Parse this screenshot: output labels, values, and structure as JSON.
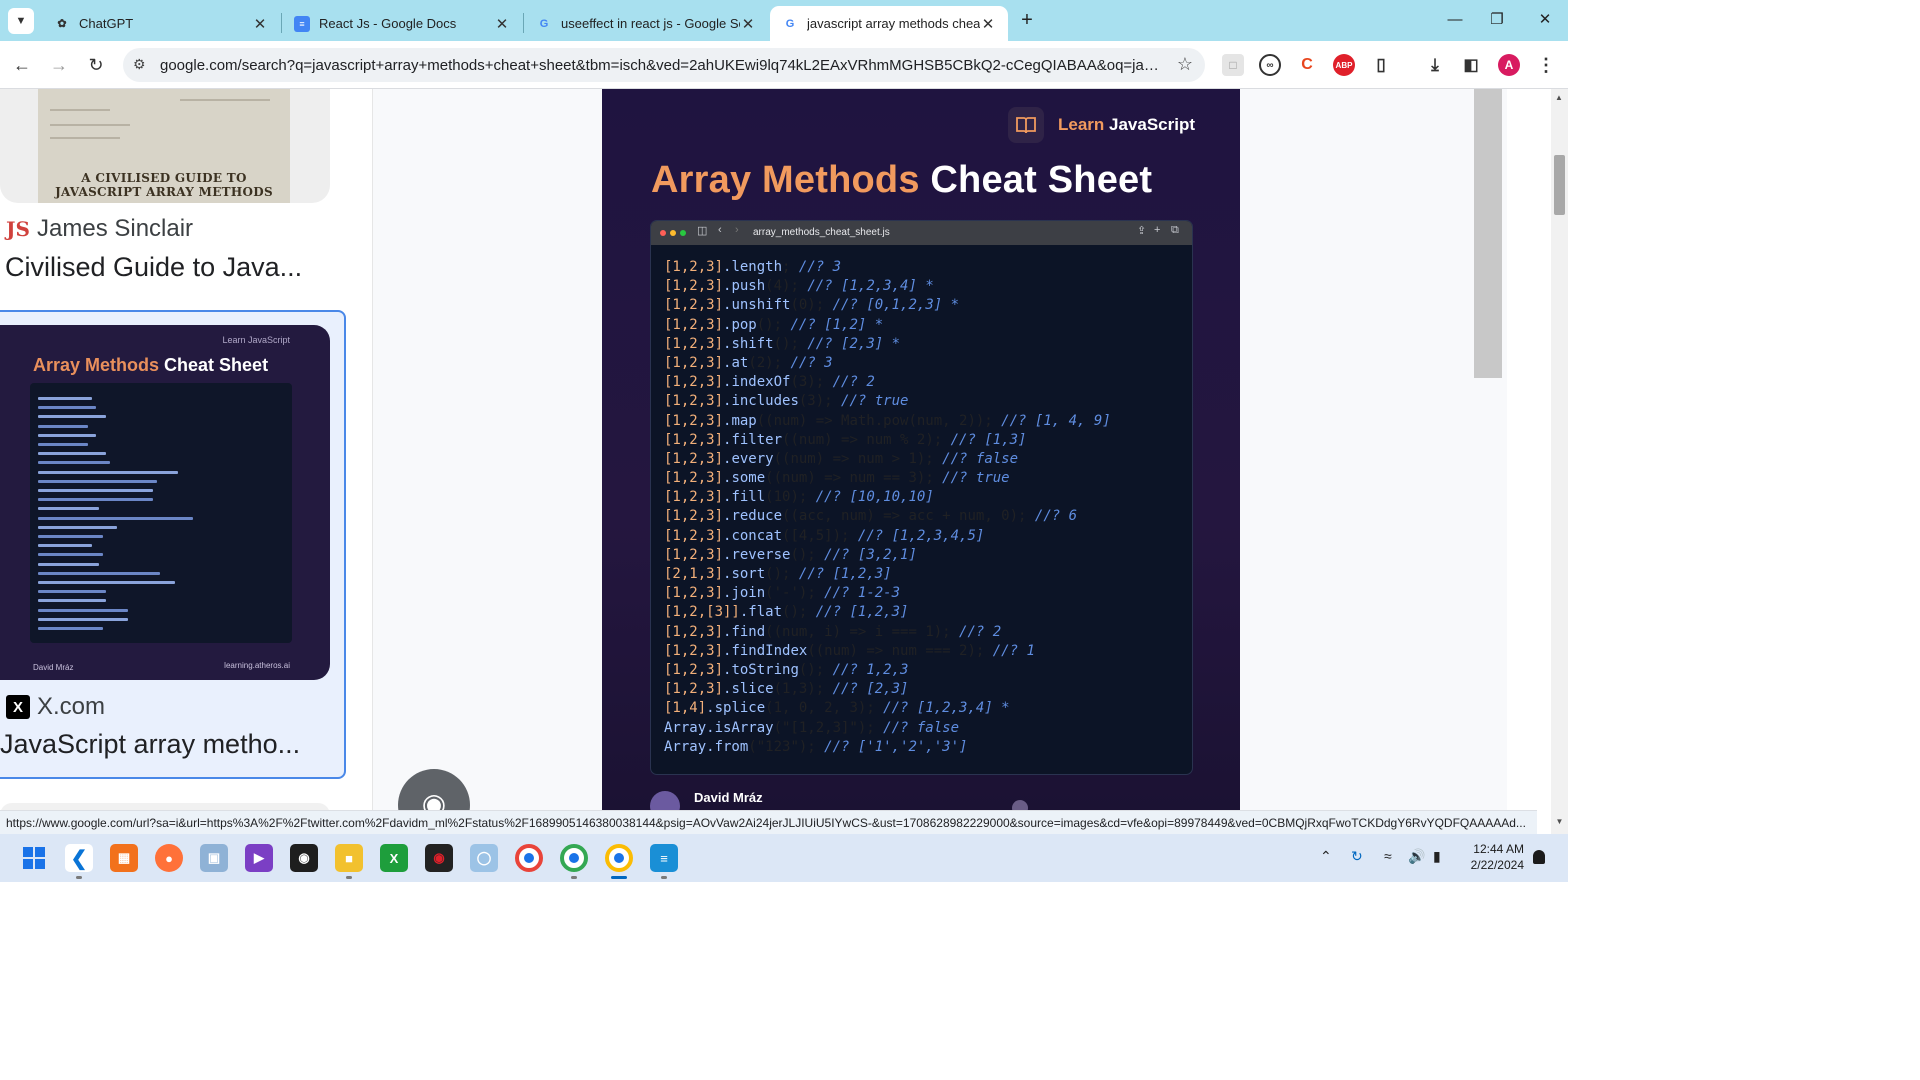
{
  "tabs": [
    {
      "title": "ChatGPT",
      "icon": "chatgpt-icon"
    },
    {
      "title": "React Js - Google Docs",
      "icon": "google-docs-icon"
    },
    {
      "title": "useeffect in react js - Google Se",
      "icon": "google-icon"
    },
    {
      "title": "javascript array methods cheat",
      "icon": "google-icon",
      "active": true
    }
  ],
  "toolbar": {
    "url": "google.com/search?q=javascript+array+methods+cheat+sheet&tbm=isch&ved=2ahUKEwi9lq74kL2EAxVRhmMGHSB5CBkQ2-cCegQIABAA&oq=javascript+a...",
    "profile_initial": "A"
  },
  "results": [
    {
      "thumb_caption": "A CIVILISED GUIDE TO JAVASCRIPT ARRAY METHODS",
      "source": "James Sinclair",
      "source_icon": "JS",
      "title": "Civilised Guide to Java..."
    },
    {
      "source": "X.com",
      "source_icon": "X",
      "title": "JavaScript array metho...",
      "selected": true,
      "thumb_brand": "Learn JavaScript",
      "thumb_title_hi": "Array Methods",
      "thumb_title_rest": " Cheat Sheet",
      "thumb_author": "David Mráz",
      "thumb_site": "learning.atheros.ai"
    }
  ],
  "sheet": {
    "brand_hi": "Learn",
    "brand_rest": " JavaScript",
    "title_hi": "Array Methods",
    "title_rest": " Cheat Sheet",
    "filename": "array_methods_cheat_sheet.js",
    "author": "David Mráz",
    "code": [
      {
        "arr": "[1,2,3]",
        "call": ".length",
        "args": ";",
        "cmt": " //? 3"
      },
      {
        "arr": "[1,2,3]",
        "call": ".push",
        "args": "(4);",
        "cmt": " //? [1,2,3,4] *"
      },
      {
        "arr": "[1,2,3]",
        "call": ".unshift",
        "args": "(0);",
        "cmt": " //? [0,1,2,3] *"
      },
      {
        "arr": "[1,2,3]",
        "call": ".pop",
        "args": "();",
        "cmt": " //? [1,2] *"
      },
      {
        "arr": "[1,2,3]",
        "call": ".shift",
        "args": "();",
        "cmt": " //? [2,3] *"
      },
      {
        "arr": "[1,2,3]",
        "call": ".at",
        "args": "(2);",
        "cmt": " //? 3"
      },
      {
        "arr": "[1,2,3]",
        "call": ".indexOf",
        "args": "(3);",
        "cmt": " //? 2"
      },
      {
        "arr": "[1,2,3]",
        "call": ".includes",
        "args": "(3);",
        "cmt": " //? true"
      },
      {
        "arr": "[1,2,3]",
        "call": ".map",
        "args": "((num) => Math.pow(num, 2));",
        "cmt": " //? [1, 4, 9]"
      },
      {
        "arr": "[1,2,3]",
        "call": ".filter",
        "args": "((num) => num % 2);",
        "cmt": " //? [1,3]"
      },
      {
        "arr": "[1,2,3]",
        "call": ".every",
        "args": "((num) => num > 1);",
        "cmt": " //? false"
      },
      {
        "arr": "[1,2,3]",
        "call": ".some",
        "args": "((num) => num == 3);",
        "cmt": " //? true"
      },
      {
        "arr": "[1,2,3]",
        "call": ".fill",
        "args": "(10);",
        "cmt": " //? [10,10,10]"
      },
      {
        "arr": "[1,2,3]",
        "call": ".reduce",
        "args": "((acc, num) => acc + num, 0);",
        "cmt": " //? 6"
      },
      {
        "arr": "[1,2,3]",
        "call": ".concat",
        "args": "([4,5]);",
        "cmt": " //? [1,2,3,4,5]"
      },
      {
        "arr": "[1,2,3]",
        "call": ".reverse",
        "args": "();",
        "cmt": " //? [3,2,1]"
      },
      {
        "arr": "[2,1,3]",
        "call": ".sort",
        "args": "();",
        "cmt": " //? [1,2,3]"
      },
      {
        "arr": "[1,2,3]",
        "call": ".join",
        "args": "('-');",
        "cmt": " //? 1-2-3"
      },
      {
        "arr": "[1,2,[3]]",
        "call": ".flat",
        "args": "();",
        "cmt": " //? [1,2,3]"
      },
      {
        "arr": "[1,2,3]",
        "call": ".find",
        "args": "((num, i) => i === 1);",
        "cmt": " //? 2"
      },
      {
        "arr": "[1,2,3]",
        "call": ".findIndex",
        "args": "((num) => num === 2);",
        "cmt": " //? 1"
      },
      {
        "arr": "[1,2,3]",
        "call": ".toString",
        "args": "();",
        "cmt": " //? 1,2,3"
      },
      {
        "arr": "[1,2,3]",
        "call": ".slice",
        "args": "(1,3);",
        "cmt": " //? [2,3]"
      },
      {
        "arr": "[1,4]",
        "call": ".splice",
        "args": "(1, 0, 2, 3);",
        "cmt": " //? [1,2,3,4] *"
      },
      {
        "arr": "",
        "call": "Array.isArray",
        "args": "(\"[1,2,3]\");",
        "cmt": " //? false"
      },
      {
        "arr": "",
        "call": "Array.from",
        "args": "(\"123\");",
        "cmt": " //? ['1','2','3']"
      }
    ]
  },
  "status_url": "https://www.google.com/url?sa=i&url=https%3A%2F%2Ftwitter.com%2Fdavidm_ml%2Fstatus%2F1689905146380038144&psig=AOvVaw2Ai24jerJLJIUiU5IYwCS-&ust=1708628982229000&source=images&cd=vfe&opi=89978449&ved=0CBMQjRxqFwoTCKDdgY6RvYQDFQAAAAAd...",
  "taskbar": {
    "time": "12:44 AM",
    "date": "2/22/2024"
  },
  "colors": {
    "tabstrip": "#a8e0ef",
    "accent_orange": "#f19a5e",
    "sheet_bg": "#1f1440",
    "editor_bg": "#0c1426",
    "selection_border": "#4a88e8"
  }
}
